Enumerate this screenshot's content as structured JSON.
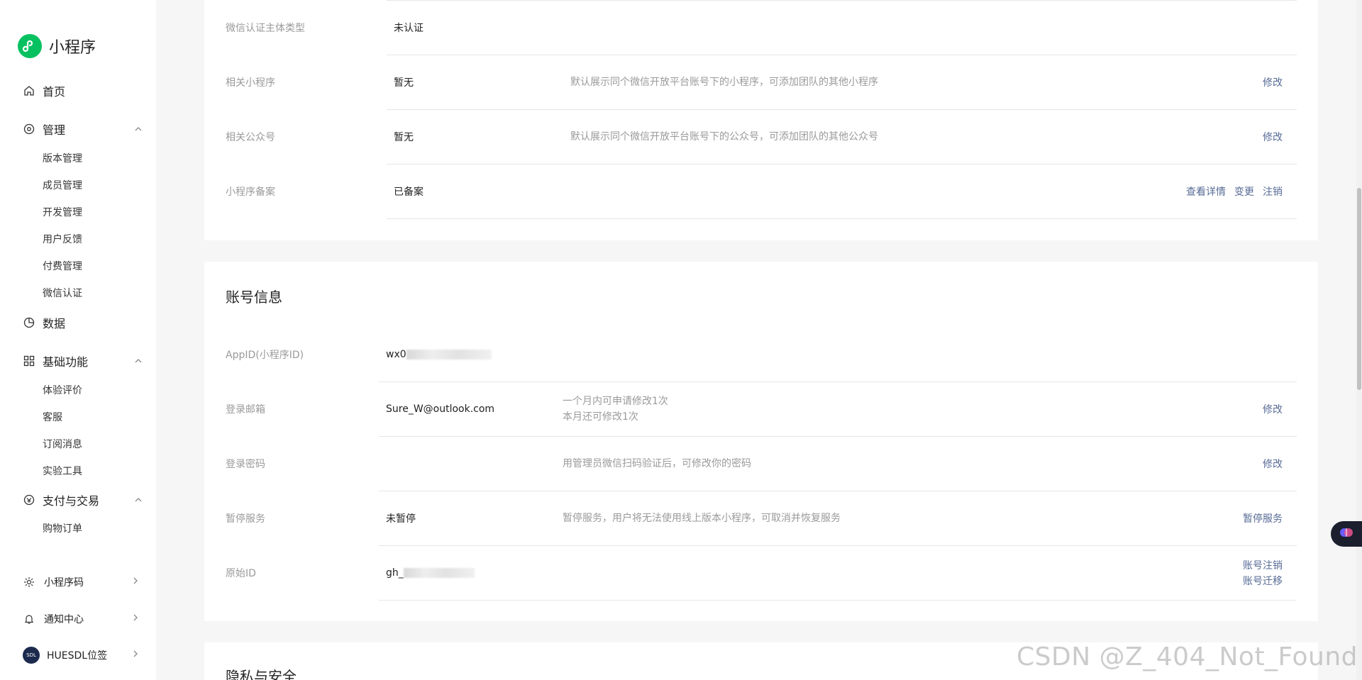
{
  "app": {
    "title": "小程序"
  },
  "sidebar": {
    "home": "首页",
    "manage": {
      "label": "管理",
      "items": [
        "版本管理",
        "成员管理",
        "开发管理",
        "用户反馈",
        "付费管理",
        "微信认证"
      ]
    },
    "data": "数据",
    "basic": {
      "label": "基础功能",
      "items": [
        "体验评价",
        "客服",
        "订阅消息",
        "实验工具"
      ]
    },
    "pay": {
      "label": "支付与交易",
      "items": [
        "购物订单"
      ]
    },
    "bottom": {
      "qrcode": "小程序码",
      "notify": "通知中心",
      "account": "HUESDL位签",
      "avatar_text": "SDL"
    }
  },
  "basic_info": {
    "rows": [
      {
        "label": "微信认证主体类型",
        "value": "未认证",
        "desc": "",
        "actions": []
      },
      {
        "label": "相关小程序",
        "value": "暂无",
        "desc": "默认展示同个微信开放平台账号下的小程序，可添加团队的其他小程序",
        "actions": [
          "修改"
        ]
      },
      {
        "label": "相关公众号",
        "value": "暂无",
        "desc": "默认展示同个微信开放平台账号下的公众号，可添加团队的其他公众号",
        "actions": [
          "修改"
        ]
      },
      {
        "label": "小程序备案",
        "value": "已备案",
        "desc": "",
        "actions": [
          "查看详情",
          "变更",
          "注销"
        ]
      }
    ]
  },
  "account_info": {
    "title": "账号信息",
    "rows": [
      {
        "label": "AppID(小程序ID)",
        "value": "wx0",
        "desc": "",
        "actions": []
      },
      {
        "label": "登录邮箱",
        "value": "Sure_W@outlook.com",
        "desc_lines": [
          "一个月内可申请修改1次",
          "本月还可修改1次"
        ],
        "actions": [
          "修改"
        ]
      },
      {
        "label": "登录密码",
        "value": "",
        "desc": "用管理员微信扫码验证后，可修改你的密码",
        "actions": [
          "修改"
        ]
      },
      {
        "label": "暂停服务",
        "value": "未暂停",
        "desc": "暂停服务，用户将无法使用线上版本小程序，可取消并恢复服务",
        "actions": [
          "暂停服务"
        ]
      },
      {
        "label": "原始ID",
        "value": "gh_",
        "desc": "",
        "actions": [
          "账号注销",
          "账号迁移"
        ]
      }
    ]
  },
  "privacy": {
    "title": "隐私与安全"
  },
  "watermark": "CSDN @Z_404_Not_Found",
  "colors": {
    "brand": "#07c160",
    "link": "#576b95",
    "muted": "#9a9a9a"
  }
}
